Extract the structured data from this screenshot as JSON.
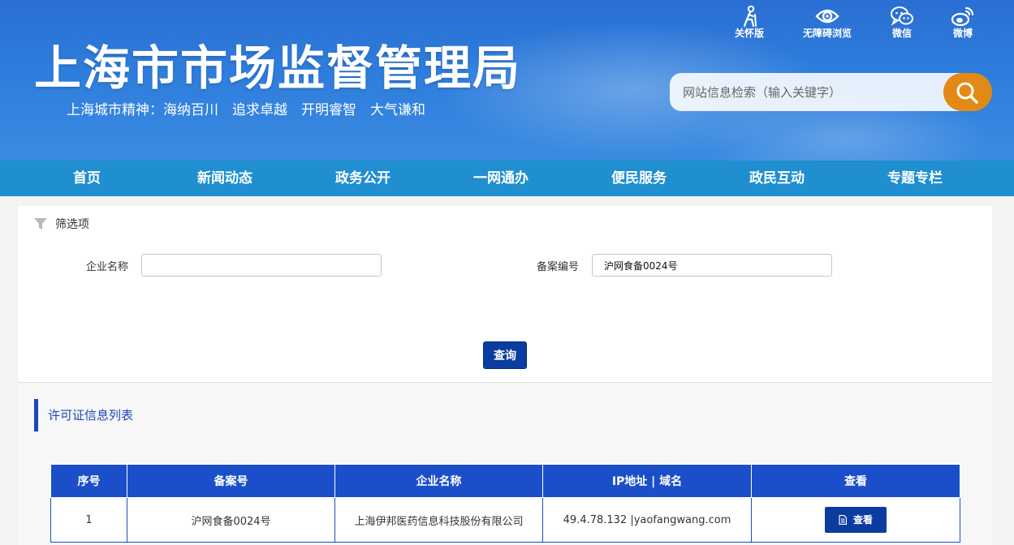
{
  "header": {
    "title": "上海市市场监督管理局",
    "slogan": "上海城市精神：海纳百川　追求卓越　开明睿智　大气谦和",
    "tools": [
      {
        "label": "关怀版",
        "icon": "care-mode-icon"
      },
      {
        "label": "无障碍浏览",
        "icon": "eye-icon"
      },
      {
        "label": "微信",
        "icon": "wechat-icon"
      },
      {
        "label": "微博",
        "icon": "weibo-icon"
      }
    ],
    "search": {
      "placeholder": "网站信息检索（输入关键字）",
      "icon": "search-icon"
    }
  },
  "nav": {
    "items": [
      "首页",
      "新闻动态",
      "政务公开",
      "一网通办",
      "便民服务",
      "政民互动",
      "专题专栏"
    ]
  },
  "filter": {
    "title": "筛选项",
    "icon": "filter-icon",
    "company_label": "企业名称",
    "company_value": "",
    "record_label": "备案编号",
    "record_value": "沪网食备0024号",
    "query_label": "查询"
  },
  "list": {
    "title": "许可证信息列表",
    "columns": [
      "序号",
      "备案号",
      "企业名称",
      "IP地址 | 域名",
      "查看"
    ],
    "rows": [
      {
        "index": "1",
        "record_no": "沪网食备0024号",
        "company": "上海伊邦医药信息科技股份有限公司",
        "ip_domain": "49.4.78.132 |yaofangwang.com",
        "view_label": "查看"
      }
    ]
  },
  "colors": {
    "brand_blue": "#0b3ca0",
    "nav_blue": "#1f8fcf",
    "table_header": "#1a4fc9",
    "search_orange": "#e28a15"
  }
}
